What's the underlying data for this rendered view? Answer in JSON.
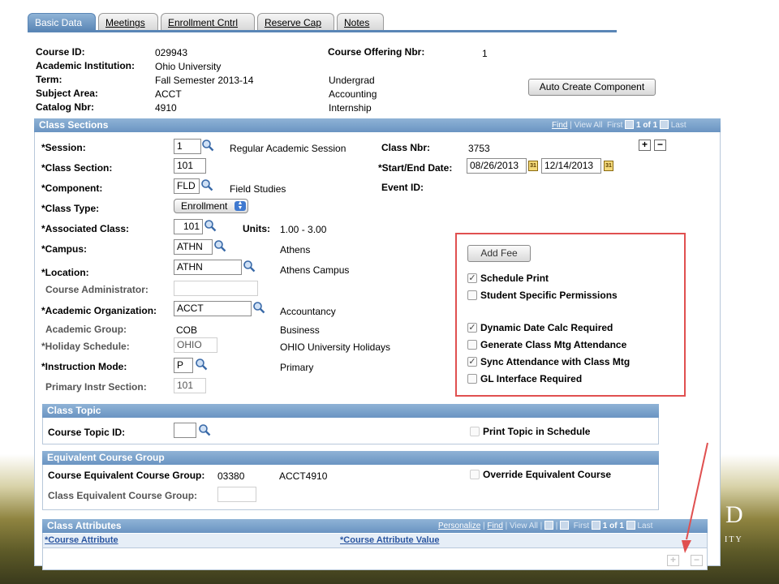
{
  "tabs": [
    {
      "label": "Basic Data",
      "active": true
    },
    {
      "label": "Meetings",
      "active": false
    },
    {
      "label": "Enrollment Cntrl",
      "active": false
    },
    {
      "label": "Reserve Cap",
      "active": false
    },
    {
      "label": "Notes",
      "active": false
    }
  ],
  "header": {
    "course_id_label": "Course ID:",
    "course_id": "029943",
    "institution_label": "Academic Institution:",
    "institution": "Ohio University",
    "term_label": "Term:",
    "term": "Fall Semester 2013-14",
    "career": "Undergrad",
    "subject_label": "Subject Area:",
    "subject": "ACCT",
    "subject_desc": "Accounting",
    "catalog_label": "Catalog Nbr:",
    "catalog": "4910",
    "catalog_desc": "Internship",
    "offering_label": "Course Offering Nbr:",
    "offering": "1",
    "auto_create_button": "Auto Create Component"
  },
  "class_sections": {
    "title": "Class Sections",
    "nav": {
      "find": "Find",
      "view_all": "View All",
      "first": "First",
      "count": "1 of 1",
      "last": "Last"
    },
    "session_label": "*Session:",
    "session": "1",
    "session_desc": "Regular Academic Session",
    "class_nbr_label": "Class Nbr:",
    "class_nbr": "3753",
    "section_label": "*Class Section:",
    "section": "101",
    "dates_label": "*Start/End Date:",
    "start_date": "08/26/2013",
    "end_date": "12/14/2013",
    "component_label": "*Component:",
    "component": "FLD",
    "component_desc": "Field Studies",
    "event_label": "Event ID:",
    "class_type_label": "*Class Type:",
    "class_type": "Enrollment",
    "assoc_label": "*Associated Class:",
    "assoc": "101",
    "units_label": "Units:",
    "units": "1.00 - 3.00",
    "campus_label": "*Campus:",
    "campus": "ATHN",
    "campus_desc": "Athens",
    "location_label": "*Location:",
    "location": "ATHN",
    "location_desc": "Athens Campus",
    "admin_label": "Course Administrator:",
    "org_label": "*Academic Organization:",
    "org": "ACCT",
    "org_desc": "Accountancy",
    "group_label": "Academic Group:",
    "group": "COB",
    "group_desc": "Business",
    "holiday_label": "*Holiday Schedule:",
    "holiday": "OHIO",
    "holiday_desc": "OHIO University Holidays",
    "mode_label": "*Instruction Mode:",
    "mode": "P",
    "mode_desc": "Primary",
    "primary_label": "Primary Instr Section:",
    "primary": "101",
    "add_fee_button": "Add Fee",
    "options": [
      {
        "label": "Schedule Print",
        "checked": true
      },
      {
        "label": "Student Specific Permissions",
        "checked": false
      },
      {
        "label": "Dynamic Date Calc Required",
        "checked": true
      },
      {
        "label": "Generate Class Mtg Attendance",
        "checked": false
      },
      {
        "label": "Sync Attendance with Class Mtg",
        "checked": true
      },
      {
        "label": "GL Interface Required",
        "checked": false
      }
    ]
  },
  "class_topic": {
    "title": "Class Topic",
    "topic_label": "Course Topic ID:",
    "print_label": "Print Topic in Schedule"
  },
  "equivalent": {
    "title": "Equivalent Course Group",
    "course_eq_label": "Course Equivalent Course Group:",
    "course_eq": "03380",
    "course_eq_desc": "ACCT4910",
    "override_label": "Override Equivalent Course",
    "class_eq_label": "Class Equivalent Course Group:"
  },
  "attributes": {
    "title": "Class Attributes",
    "nav": {
      "personalize": "Personalize",
      "find": "Find",
      "view_all": "View All",
      "first": "First",
      "count": "1 of 1",
      "last": "Last"
    },
    "col_attribute": "*Course Attribute",
    "col_value": "*Course Attribute Value"
  },
  "brand": {
    "letter": "D",
    "suffix": "ITY"
  },
  "colors": {
    "accent": "#6a94c2",
    "highlight": "#e05050"
  }
}
